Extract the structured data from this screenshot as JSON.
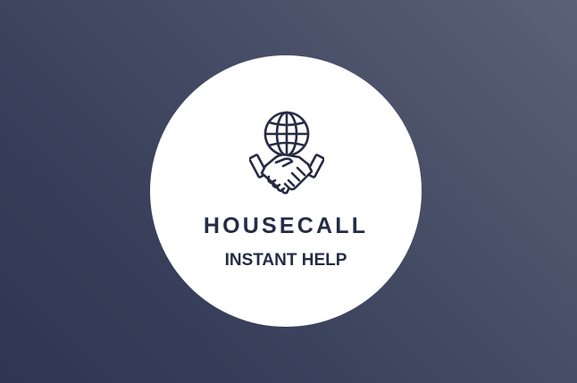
{
  "logo": {
    "icon": "globe-handshake-icon",
    "name": "HOUSECALL",
    "tagline": "INSTANT HELP",
    "color": "#262c44"
  },
  "colors": {
    "background_dark": "#2f3651",
    "background_light": "#5b6176",
    "badge": "#ffffff"
  }
}
